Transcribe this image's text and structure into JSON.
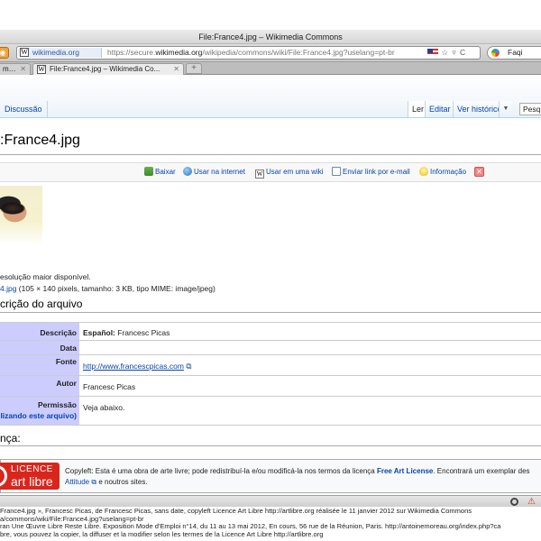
{
  "window": {
    "title": "File:France4.jpg – Wikimedia Commons"
  },
  "toolbar": {
    "site_badge": "wikimedia.org",
    "url_prefix": "https://secure.",
    "url_domain": "wikimedia.org",
    "url_path": "/wikipedia/commons/wiki/File:France4.jpg?uselang=pt-br",
    "url_right_icons": "☆ ▿ C",
    "search_text": "Faqi"
  },
  "tabs": [
    {
      "label": "m…"
    },
    {
      "label": "File:France4.jpg – Wikimedia Co..."
    }
  ],
  "wiki_tabs": {
    "discussion": "Discussão",
    "read": "Ler",
    "edit": "Editar",
    "history": "Ver histórico",
    "more": "▼",
    "search_value": "Pesq"
  },
  "page": {
    "title": ":France4.jpg",
    "actions": [
      "Baixar",
      "Usar na internet",
      "Usar em uma wiki",
      "Enviar link por e-mail",
      "Informação"
    ],
    "res_note": "esolução maior disponível.",
    "file_link": "4.jpg",
    "file_meta": " (105 × 140 pixels, tamanho: 3 KB, tipo MIME: image/jpeg)",
    "section_heading": "crição do arquivo",
    "info_rows": [
      {
        "label": "Descrição",
        "value_bold": "Español:",
        "value": " Francesc Picas"
      },
      {
        "label": "Data",
        "value": ""
      },
      {
        "label": "Fonte",
        "link": "http://www.francescpicas.com"
      },
      {
        "label": "Autor",
        "value": "Francesc Picas"
      },
      {
        "label": "Permissão",
        "label2": "tilizando este arquivo)",
        "value": "Veja abaixo."
      }
    ],
    "license_heading": "nça:",
    "license": {
      "logo_line1": "LICENCE",
      "logo_line2": "art libre",
      "text1": "Copyleft: Esta é uma obra de arte livre; pode redistribuí-la e/ou modificá-la nos termos da licença ",
      "link_license": "Free Art License",
      "text2": ". Encontrará um exemplar des",
      "link_attitude": "Attitude",
      "text3": " e noutros sites."
    }
  },
  "meta_lines": [
    "France4.jpg », Francesc Picas, de Francesc Picas, sans date, copyleft Licence Art Libre http://artlibre.org réalisée le 11 janvier 2012 sur Wikimedia Commons",
    "a/commons/wiki/File:France4.jpg?uselang=pt-br",
    "ran Une Œuvre Libre Reste Libre. Exposition Mode d'Emploi n°14, du 11 au 13 mai 2012, En cours, 56 rue de la Réunion, Paris. http://antoinemoreau.org/index.php?ca",
    "bre, vous pouvez la copier, la diffuser et la modifier selon les termes de la Licence Art Libre http://artlibre.org"
  ],
  "colors": {
    "link": "#0645ad",
    "label_bg": "#ccccff",
    "lal_red": "#d9261c"
  }
}
